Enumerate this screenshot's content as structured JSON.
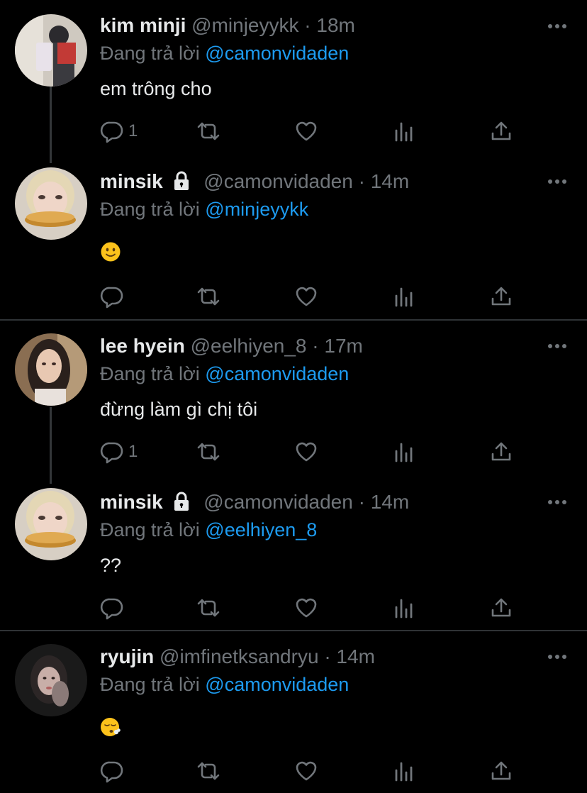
{
  "tweets": [
    {
      "name": "kim minji",
      "locked": false,
      "handle": "@minjeyykk",
      "sep": "·",
      "time": "18m",
      "reply_prefix": "Đang trả lời",
      "reply_to": "@camonvidaden",
      "text": "em trông cho",
      "reply_count": "1",
      "avatar_icon": "avatar-photo"
    },
    {
      "name": "minsik",
      "locked": true,
      "handle": "@camonvidaden",
      "sep": "·",
      "time": "14m",
      "reply_prefix": "Đang trả lời",
      "reply_to": "@minjeyykk",
      "text": "",
      "emoji": "slightly-smiling-face",
      "reply_count": "",
      "avatar_icon": "avatar-photo"
    },
    {
      "name": "lee hyein",
      "locked": false,
      "handle": "@eelhiyen_8",
      "sep": "·",
      "time": "17m",
      "reply_prefix": "Đang trả lời",
      "reply_to": "@camonvidaden",
      "text": "đừng làm gì chị tôi",
      "reply_count": "1",
      "avatar_icon": "avatar-photo"
    },
    {
      "name": "minsik",
      "locked": true,
      "handle": "@camonvidaden",
      "sep": "·",
      "time": "14m",
      "reply_prefix": "Đang trả lời",
      "reply_to": "@eelhiyen_8",
      "text": "??",
      "reply_count": "",
      "avatar_icon": "avatar-photo"
    },
    {
      "name": "ryujin",
      "locked": false,
      "handle": "@imfinetksandryu",
      "sep": "·",
      "time": "14m",
      "reply_prefix": "Đang trả lời",
      "reply_to": "@camonvidaden",
      "text": "",
      "emoji": "face-exhaling",
      "reply_count": "",
      "avatar_icon": "avatar-photo"
    }
  ],
  "colors": {
    "background": "#000000",
    "text": "#e7e9ea",
    "muted": "#71767b",
    "accent": "#1d9bf0",
    "divider": "#2f3336"
  },
  "icons": {
    "reply": "reply-icon",
    "retweet": "retweet-icon",
    "like": "like-icon",
    "views": "views-icon",
    "share": "share-icon",
    "more": "more-icon",
    "lock": "lock-icon"
  }
}
